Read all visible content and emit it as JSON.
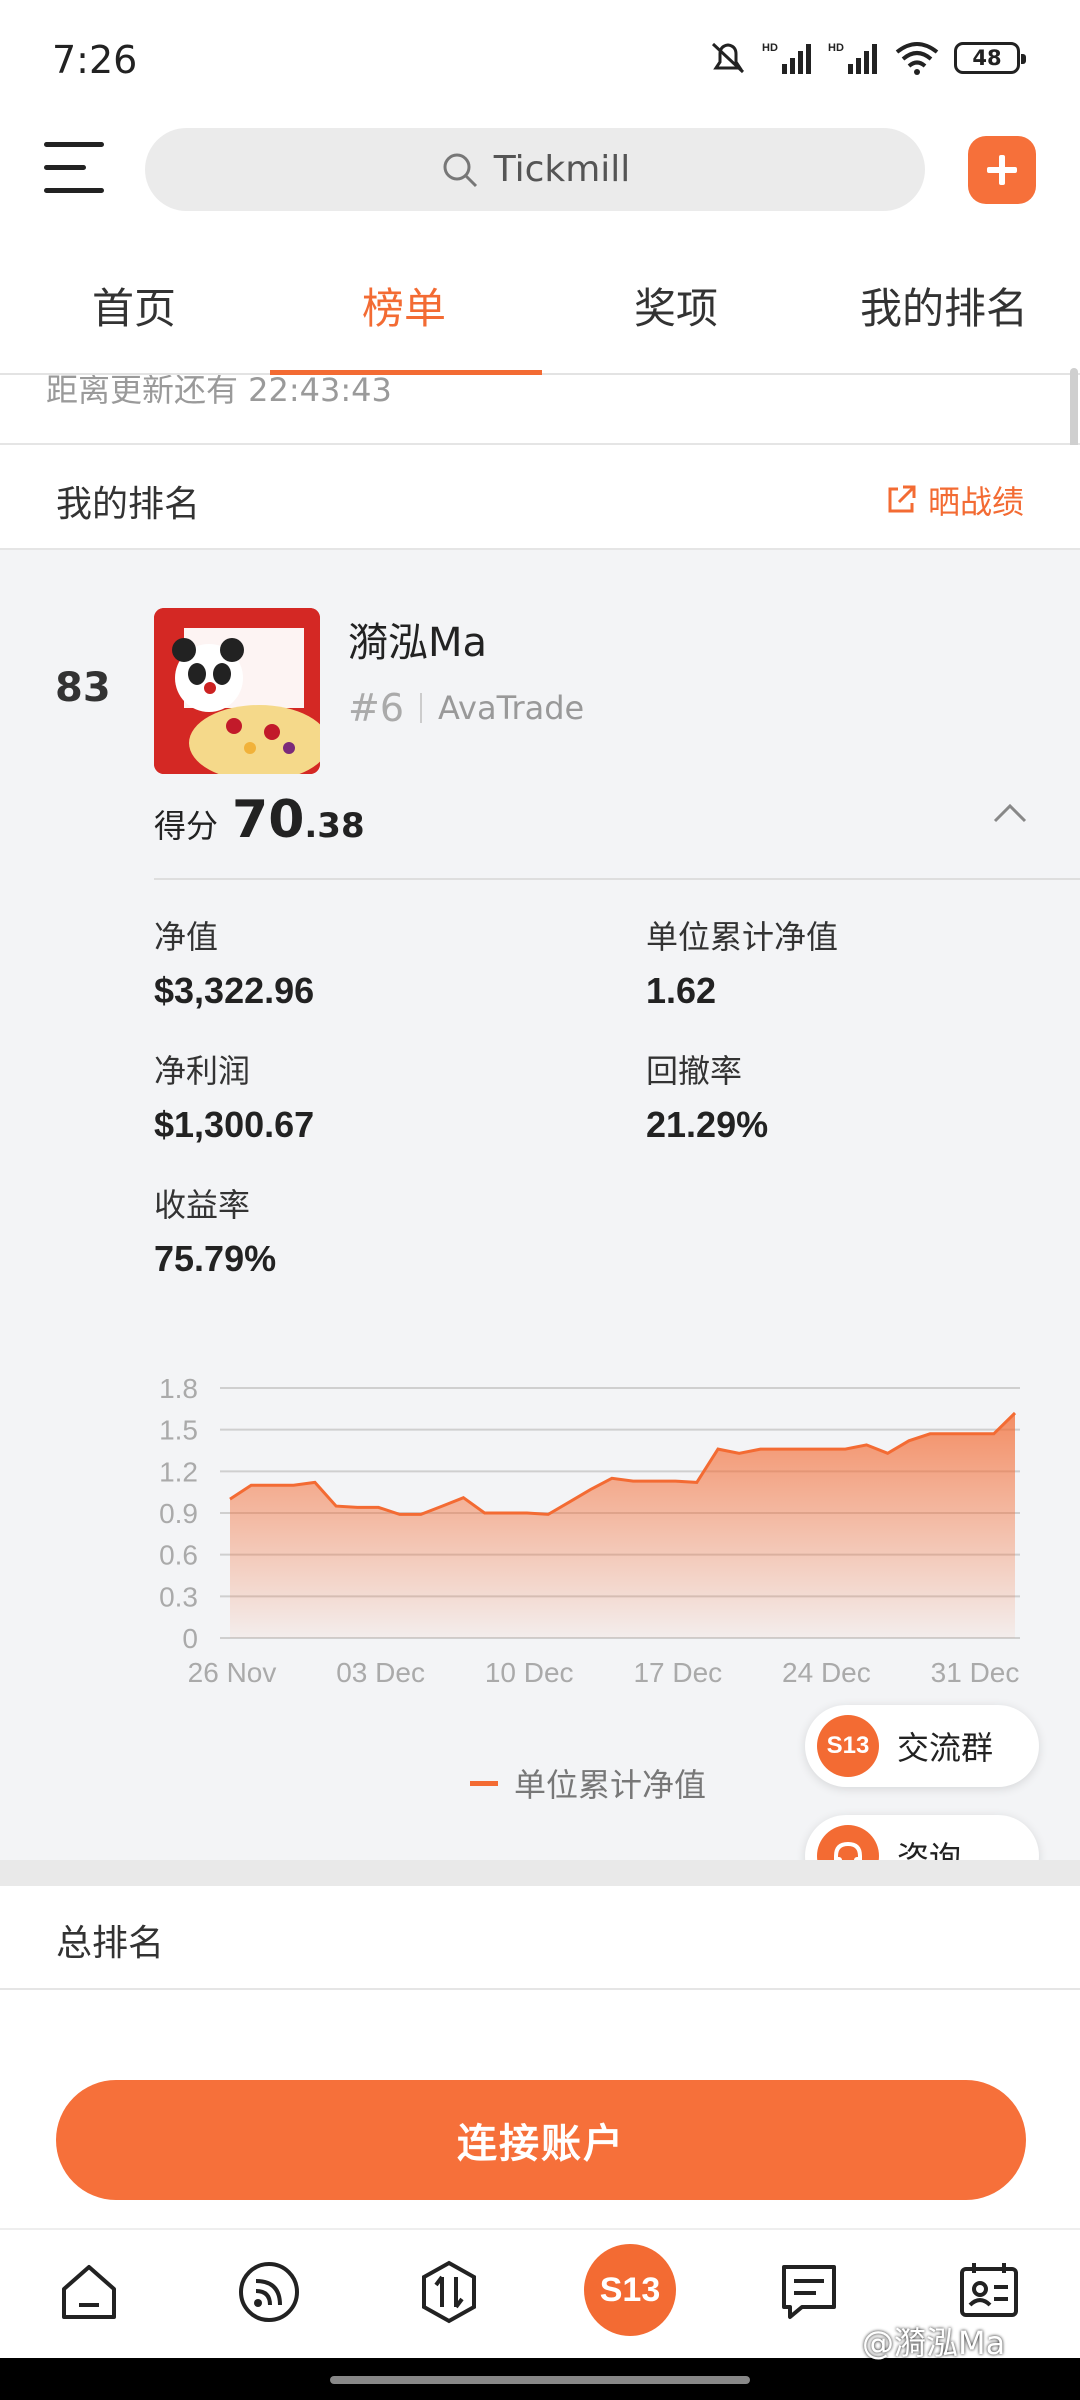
{
  "status": {
    "time": "7:26",
    "battery": "48"
  },
  "search": {
    "placeholder": "Tickmill"
  },
  "tabs": [
    "首页",
    "榜单",
    "奖项",
    "我的排名"
  ],
  "countdown": "距离更新还有 22:43:43",
  "my_rank_section": {
    "title": "我的排名",
    "share": "晒战绩"
  },
  "user": {
    "rank": "83",
    "name": "漪泓Ma",
    "tag": "#6",
    "broker": "AvaTrade",
    "score_label": "得分",
    "score_int": "70",
    "score_dec": ".38"
  },
  "stats": [
    {
      "label": "净值",
      "value": "$3,322.96"
    },
    {
      "label": "单位累计净值",
      "value": "1.62"
    },
    {
      "label": "净利润",
      "value": "$1,300.67"
    },
    {
      "label": "回撤率",
      "value": "21.29%"
    },
    {
      "label": "收益率",
      "value": "75.79%"
    }
  ],
  "chart_data": {
    "type": "area",
    "x_ticks": [
      "26 Nov",
      "03 Dec",
      "10 Dec",
      "17 Dec",
      "24 Dec",
      "31 Dec"
    ],
    "y_ticks": [
      "1.8",
      "1.5",
      "1.2",
      "0.9",
      "0.6",
      "0.3",
      "0"
    ],
    "ylim": [
      0,
      1.8
    ],
    "series": [
      {
        "name": "单位累计净值",
        "color": "#f36b33",
        "values": [
          1.0,
          1.1,
          1.1,
          1.1,
          1.12,
          0.95,
          0.94,
          0.94,
          0.89,
          0.89,
          0.95,
          1.01,
          0.9,
          0.9,
          0.9,
          0.89,
          0.98,
          1.07,
          1.15,
          1.13,
          1.13,
          1.13,
          1.12,
          1.36,
          1.33,
          1.36,
          1.36,
          1.36,
          1.36,
          1.36,
          1.39,
          1.33,
          1.42,
          1.47,
          1.47,
          1.47,
          1.47,
          1.62
        ]
      }
    ]
  },
  "fab": {
    "group": "交流群",
    "consult": "咨询"
  },
  "total_section": {
    "title": "总排名"
  },
  "connect_button": "连接账户",
  "nav_logo": "S13",
  "watermark": "@漪泓Ma"
}
